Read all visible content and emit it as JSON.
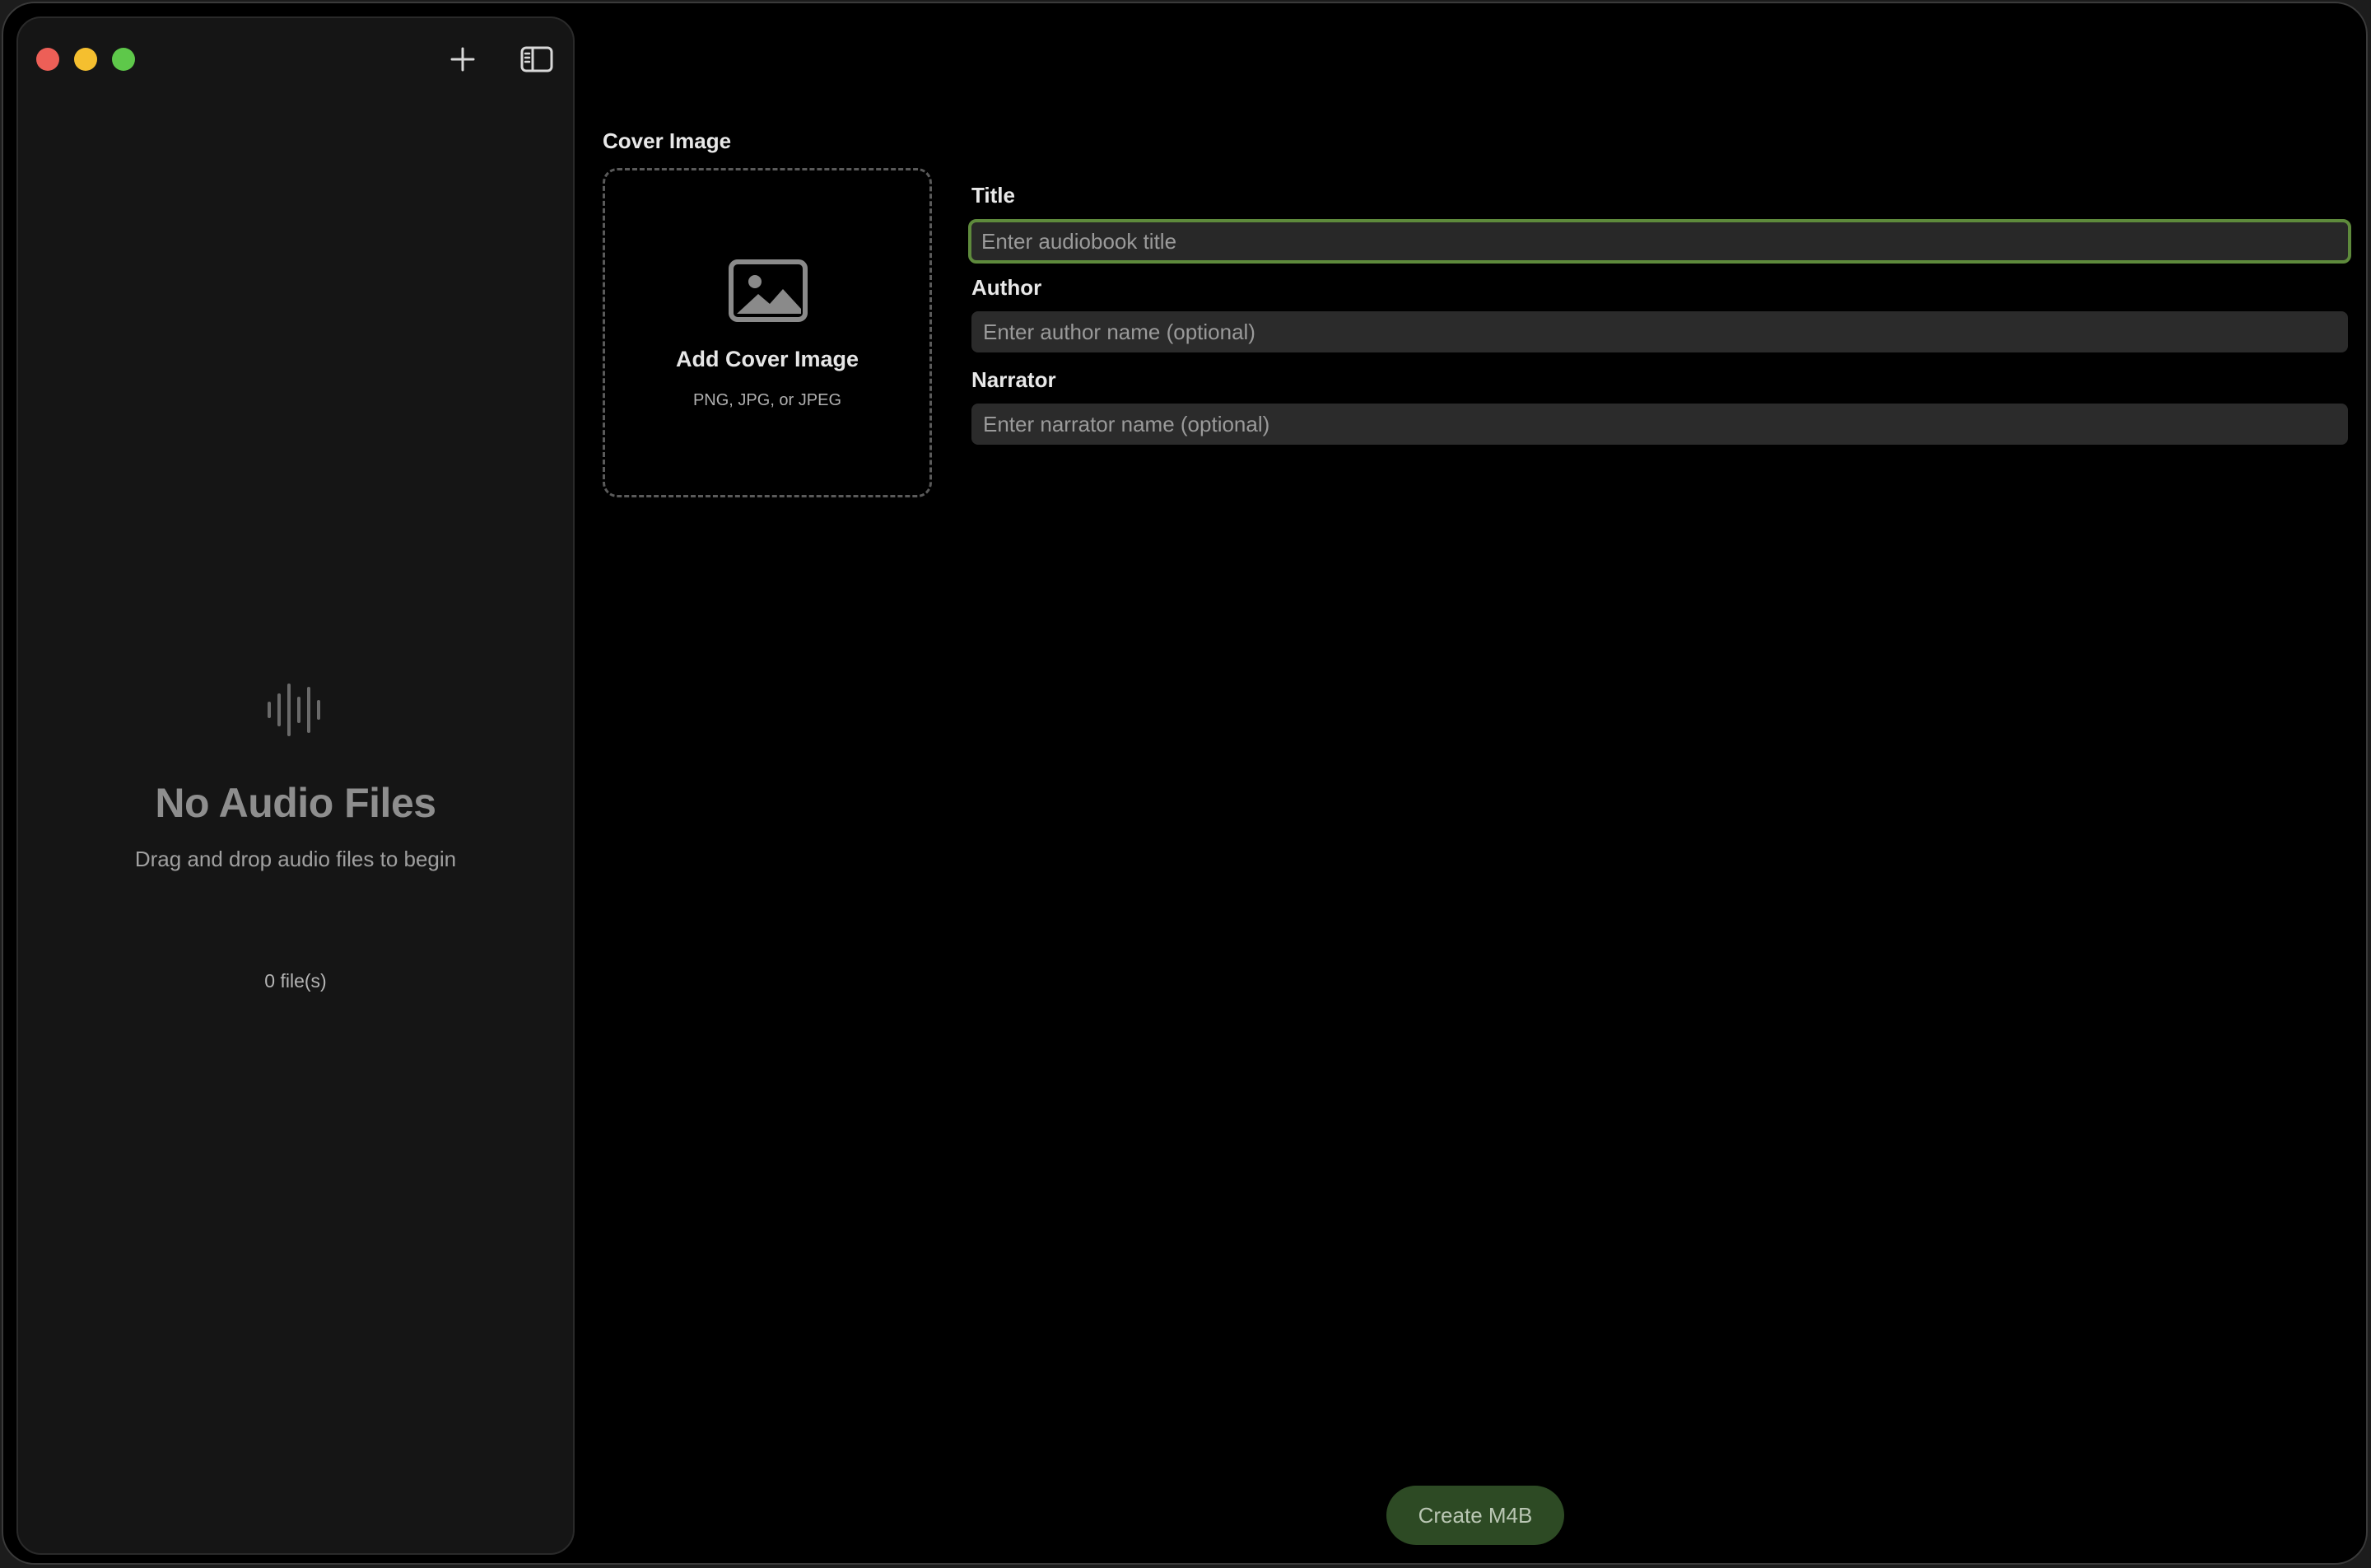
{
  "window": {
    "traffic_lights": [
      "close",
      "minimize",
      "zoom"
    ]
  },
  "sidebar": {
    "toolbar": {
      "add_icon": "plus-icon",
      "toggle_icon": "sidebar-toggle-icon"
    },
    "empty_state": {
      "icon": "waveform-icon",
      "title": "No Audio Files",
      "subtitle": "Drag and drop audio files to begin"
    },
    "file_count": "0 file(s)"
  },
  "main": {
    "cover": {
      "label": "Cover Image",
      "icon": "photo-icon",
      "title": "Add Cover Image",
      "subtitle": "PNG, JPG, or JPEG"
    },
    "fields": {
      "title": {
        "label": "Title",
        "placeholder": "Enter audiobook title",
        "value": ""
      },
      "author": {
        "label": "Author",
        "placeholder": "Enter author name (optional)",
        "value": ""
      },
      "narrator": {
        "label": "Narrator",
        "placeholder": "Enter narrator name (optional)",
        "value": ""
      }
    },
    "create_button": "Create M4B"
  },
  "colors": {
    "accent": "#5e8a3c",
    "button_bg": "#2d4a24",
    "close": "#ed5f57",
    "minimize": "#f5bf2f",
    "zoom": "#5ec84a"
  }
}
